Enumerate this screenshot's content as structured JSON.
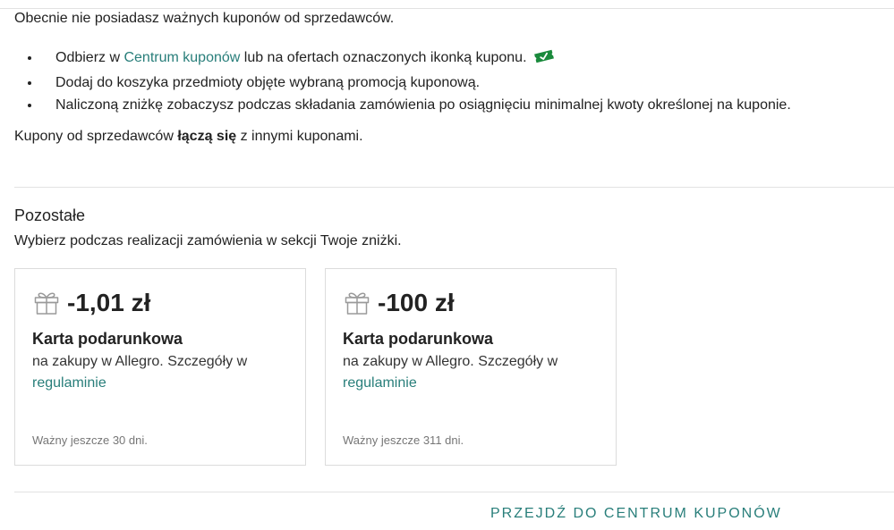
{
  "notice": "Obecnie nie posiadasz ważnych kuponów od sprzedawców.",
  "steps": [
    {
      "prefix": "Odbierz w ",
      "link": "Centrum kuponów",
      "suffix": " lub na ofertach oznaczonych ikonką kuponu."
    },
    {
      "text": "Dodaj do koszyka przedmioty objęte wybraną promocją kuponową."
    },
    {
      "text": "Naliczoną zniżkę zobaczysz podczas składania zamówienia po osiągnięciu minimalnej kwoty określonej na kuponie."
    }
  ],
  "combine": {
    "prefix": "Kupony od sprzedawców ",
    "bold": "łączą się",
    "suffix": " z innymi kuponami."
  },
  "others": {
    "title": "Pozostałe",
    "description": "Wybierz podczas realizacji zamówienia w sekcji Twoje zniżki.",
    "cards": [
      {
        "icon": "gift-icon",
        "amount": "-1,01 zł",
        "title": "Karta podarunkowa",
        "description": "na zakupy w Allegro. Szczegóły w ",
        "link": "regulaminie",
        "validity": "Ważny jeszcze 30 dni."
      },
      {
        "icon": "gift-icon",
        "amount": "-100 zł",
        "title": "Karta podarunkowa",
        "description": "na zakupy w Allegro. Szczegóły w ",
        "link": "regulaminie",
        "validity": "Ważny jeszcze 311 dni."
      }
    ]
  },
  "cta": "PRZEJDŹ DO CENTRUM KUPONÓW",
  "colors": {
    "link": "#287e7a",
    "coupon_icon": "#1a8a3c",
    "border": "#dcdcdc"
  }
}
